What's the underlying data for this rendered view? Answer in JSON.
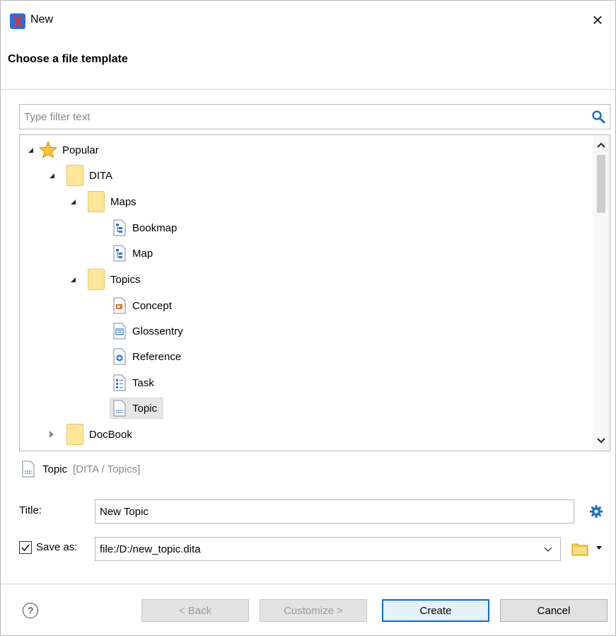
{
  "window": {
    "title": "New",
    "close_glyph": "×"
  },
  "heading": "Choose a file template",
  "filter": {
    "placeholder": "Type filter text",
    "value": ""
  },
  "tree": {
    "items": [
      {
        "label": "Popular",
        "level": 0,
        "icon": "star-icon",
        "state": "expanded"
      },
      {
        "label": "DITA",
        "level": 1,
        "icon": "folder-icon",
        "state": "expanded"
      },
      {
        "label": "Maps",
        "level": 2,
        "icon": "folder-icon",
        "state": "expanded"
      },
      {
        "label": "Bookmap",
        "level": 3,
        "icon": "map-file-icon",
        "state": "leaf"
      },
      {
        "label": "Map",
        "level": 3,
        "icon": "map-file-icon",
        "state": "leaf"
      },
      {
        "label": "Topics",
        "level": 2,
        "icon": "folder-icon",
        "state": "expanded"
      },
      {
        "label": "Concept",
        "level": 3,
        "icon": "concept-file-icon",
        "state": "leaf"
      },
      {
        "label": "Glossentry",
        "level": 3,
        "icon": "glossentry-file-icon",
        "state": "leaf"
      },
      {
        "label": "Reference",
        "level": 3,
        "icon": "reference-file-icon",
        "state": "leaf"
      },
      {
        "label": "Task",
        "level": 3,
        "icon": "task-file-icon",
        "state": "leaf"
      },
      {
        "label": "Topic",
        "level": 3,
        "icon": "topic-file-icon",
        "state": "leaf",
        "selected": true
      },
      {
        "label": "DocBook",
        "level": 1,
        "icon": "folder-icon",
        "state": "collapsed"
      }
    ]
  },
  "selected_template": {
    "name": "Topic",
    "path": "[DITA / Topics]"
  },
  "title_field": {
    "label": "Title:",
    "value": "New Topic"
  },
  "save_as": {
    "label": "Save as:",
    "checked": true,
    "value": "file:/D:/new_topic.dita"
  },
  "buttons": {
    "help": "?",
    "back": "< Back",
    "customize": "Customize >",
    "create": "Create",
    "cancel": "Cancel"
  },
  "colors": {
    "accent": "#0b6fd0",
    "folder": "#fde699",
    "selection": "#e6e6e6"
  }
}
